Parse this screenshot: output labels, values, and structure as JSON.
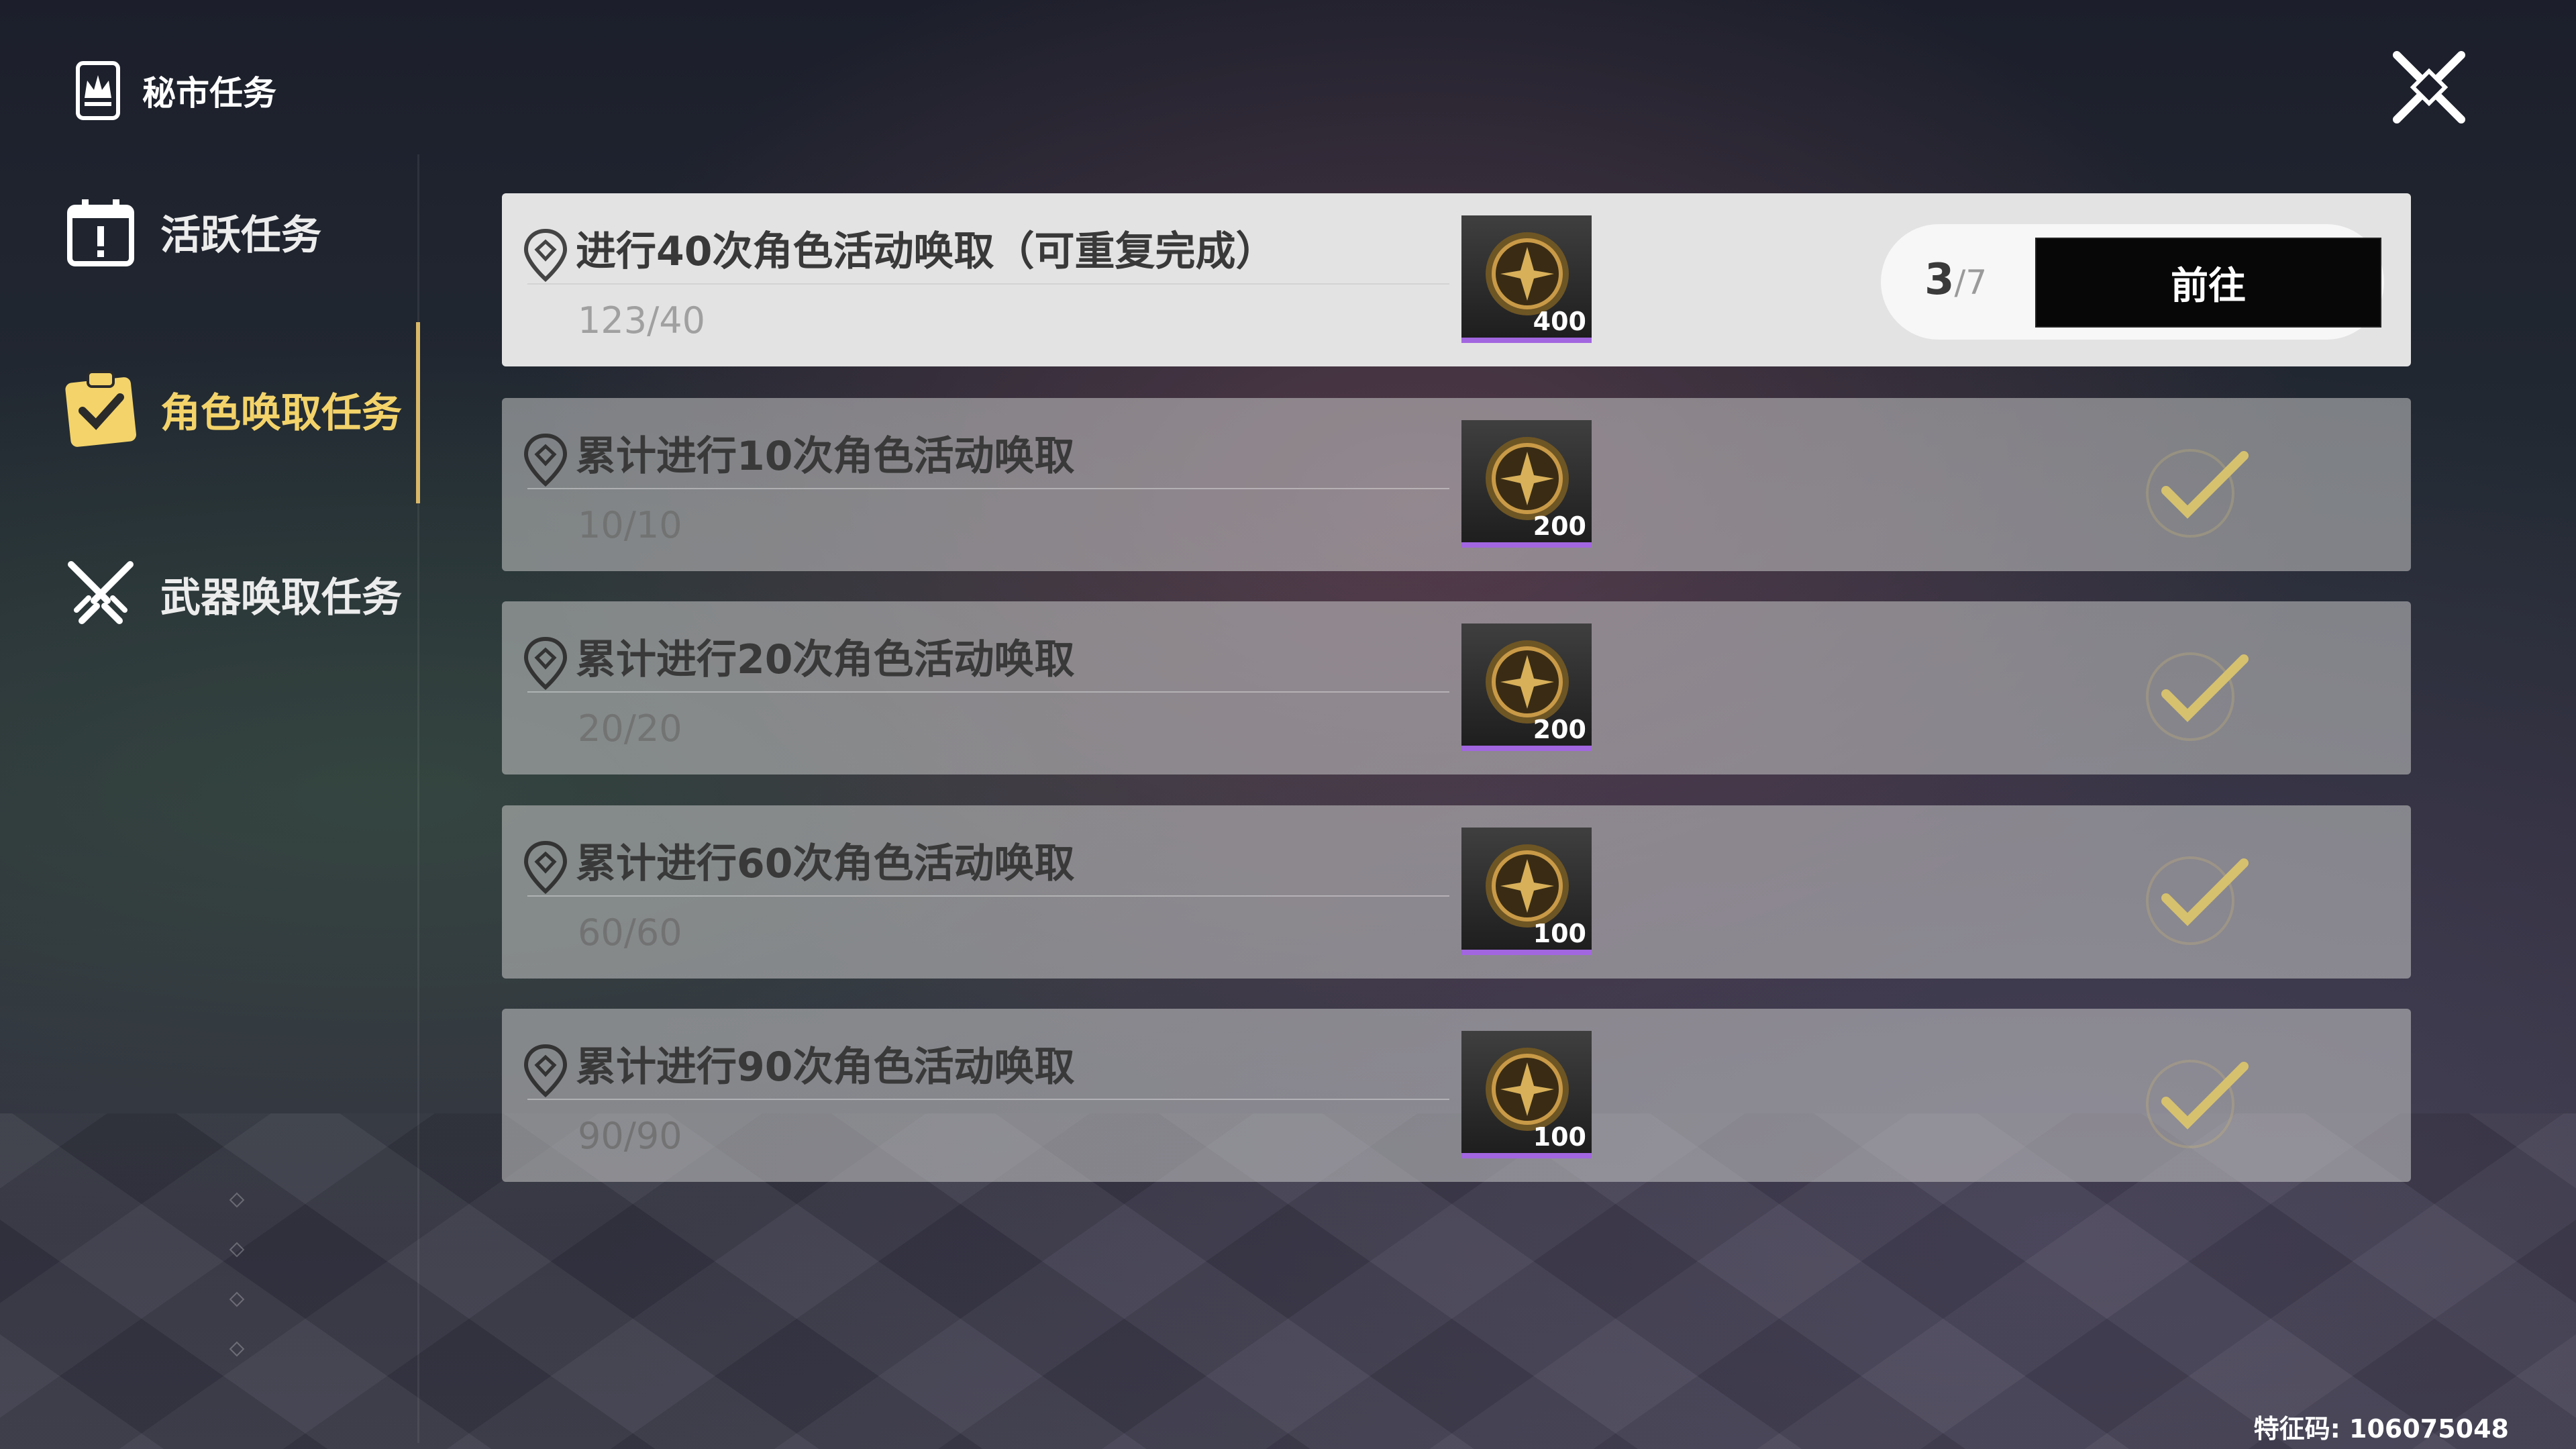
{
  "header": {
    "title": "秘市任务",
    "icon": "secret-market-icon"
  },
  "sidebar": {
    "items": [
      {
        "label": "活跃任务",
        "icon": "calendar-alert-icon",
        "active": false
      },
      {
        "label": "角色唤取任务",
        "icon": "clipboard-check-icon",
        "active": true
      },
      {
        "label": "武器唤取任务",
        "icon": "crossed-swords-icon",
        "active": false
      }
    ]
  },
  "close": {
    "icon": "close-x-icon"
  },
  "tasks": [
    {
      "title": "进行40次角色活动唤取（可重复完成）",
      "progress": "123/40",
      "reward_amount": "400",
      "repeat_done": "3",
      "repeat_total": "/7",
      "button_label": "前往",
      "completed": false
    },
    {
      "title": "累计进行10次角色活动唤取",
      "progress": "10/10",
      "reward_amount": "200",
      "completed": true
    },
    {
      "title": "累计进行20次角色活动唤取",
      "progress": "20/20",
      "reward_amount": "200",
      "completed": true
    },
    {
      "title": "累计进行60次角色活动唤取",
      "progress": "60/60",
      "reward_amount": "100",
      "completed": true
    },
    {
      "title": "累计进行90次角色活动唤取",
      "progress": "90/90",
      "reward_amount": "100",
      "completed": true
    }
  ],
  "footer": {
    "fingerprint": "特征码: 106075048"
  },
  "colors": {
    "accent": "#f3d36a",
    "reward_bar": "#a266e0",
    "button_bg": "#070707",
    "check": "#d6c16e"
  }
}
